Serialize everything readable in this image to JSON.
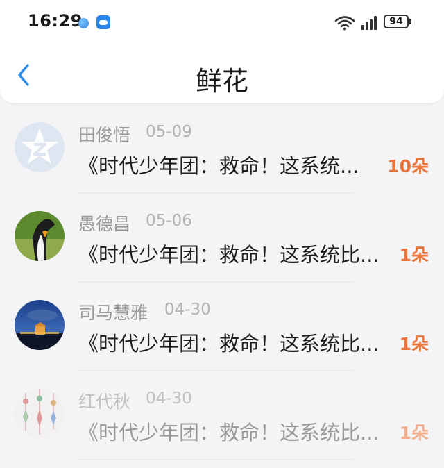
{
  "status_bar": {
    "time": "16:29",
    "battery": "94",
    "icons": [
      "browser-icon",
      "weather-app-icon",
      "wifi-icon",
      "signal-icon",
      "battery-icon"
    ]
  },
  "header": {
    "title": "鲜花",
    "back_icon": "chevron-left-icon"
  },
  "colors": {
    "accent": "#2b8be6",
    "flower_count": "#e8743a"
  },
  "items": [
    {
      "name": "田俊悟",
      "date": "05-09",
      "message": "《时代少年团：救命！这系统...",
      "flowers": "10朵",
      "avatar": "qzone-star-avatar"
    },
    {
      "name": "愚德昌",
      "date": "05-06",
      "message": "《时代少年团：救命！这系统比...",
      "flowers": "1朵",
      "avatar": "penguin-photo-avatar"
    },
    {
      "name": "司马慧雅",
      "date": "04-30",
      "message": "《时代少年团：救命！这系统比...",
      "flowers": "1朵",
      "avatar": "night-cityscape-avatar"
    },
    {
      "name": "红代秋",
      "date": "04-30",
      "message": "《时代少年团：救命！这系统比...",
      "flowers": "1朵",
      "avatar": "hanging-ornaments-avatar"
    }
  ]
}
